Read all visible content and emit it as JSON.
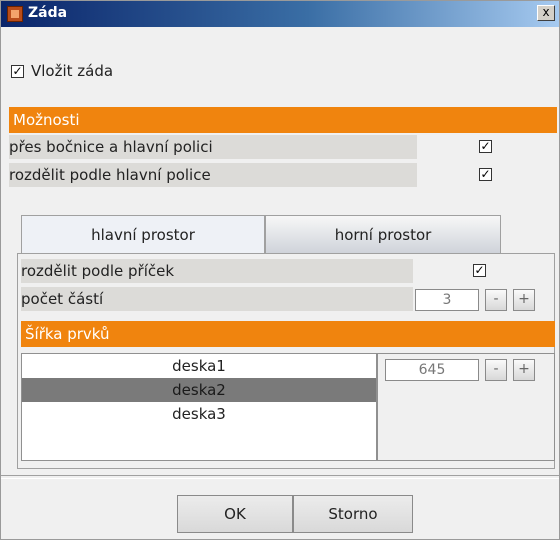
{
  "window": {
    "title": "Záda",
    "close_glyph": "x"
  },
  "insert_back": {
    "label": "Vložit záda",
    "checked": true
  },
  "options": {
    "header": "Možnosti",
    "rows": [
      {
        "label": "přes bočnice a hlavní polici",
        "checked": true
      },
      {
        "label": "rozdělit podle hlavní police",
        "checked": true
      }
    ]
  },
  "tabs": [
    {
      "label": "hlavní prostor",
      "active": true
    },
    {
      "label": "horní prostor",
      "active": false
    }
  ],
  "main_space": {
    "split_label": "rozdělit podle příček",
    "split_checked": true,
    "parts_label": "počet částí",
    "parts_value": "3",
    "minus": "-",
    "plus": "+"
  },
  "widths": {
    "header": "Šířka prvků",
    "items": [
      "deska1",
      "deska2",
      "deska3"
    ],
    "selected_index": 1,
    "value": "645",
    "minus": "-",
    "plus": "+"
  },
  "buttons": {
    "ok": "OK",
    "cancel": "Storno"
  },
  "colors": {
    "accent": "#f0840e",
    "title_bar": "#0a246a",
    "selected_row": "#7a7a7a"
  },
  "icons": {
    "app": "app-window-icon",
    "close": "close-icon",
    "check": "checkmark-icon"
  }
}
